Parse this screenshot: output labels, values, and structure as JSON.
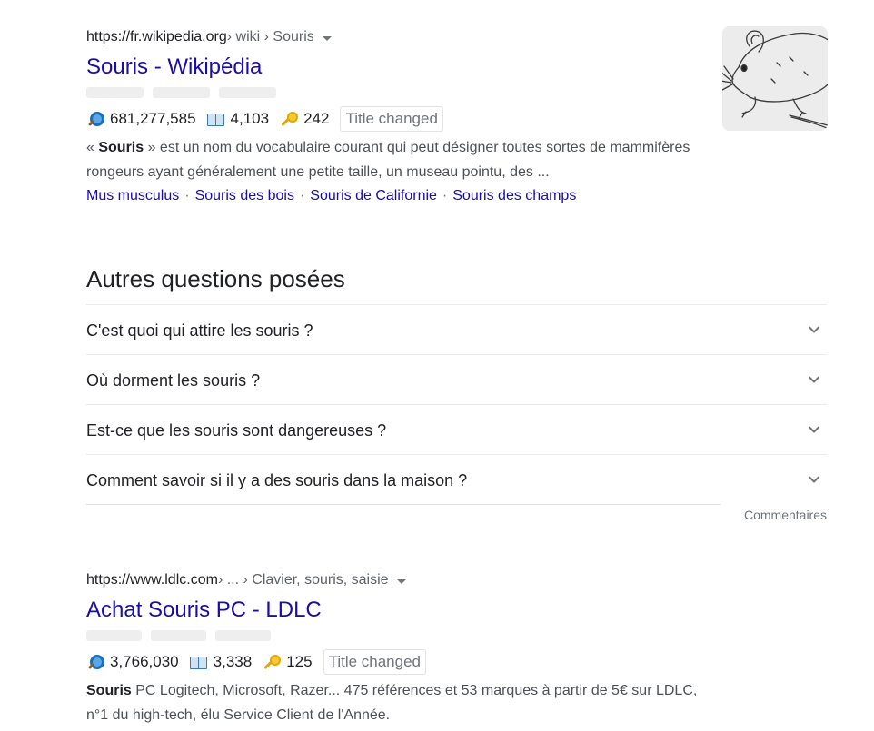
{
  "results": [
    {
      "url_host": "https://fr.wikipedia.org",
      "url_path": " › wiki › Souris",
      "title": "Souris - Wikipédia",
      "stats": {
        "searches": "681,277,585",
        "pages": "4,103",
        "keys": "242",
        "badge": "Title changed"
      },
      "snippet_open": "« ",
      "snippet_bold": "Souris",
      "snippet_rest": " » est un nom du vocabulaire courant qui peut désigner toutes sortes de mammifères rongeurs ayant généralement une petite taille, un museau pointu, des ...",
      "sitelinks": [
        "Mus musculus",
        "Souris des bois",
        "Souris de Californie",
        "Souris des champs"
      ],
      "sitelink_sep": "·"
    },
    {
      "url_host": "https://www.ldlc.com",
      "url_path": " › ... › Clavier, souris, saisie",
      "title": "Achat Souris PC - LDLC",
      "stats": {
        "searches": "3,766,030",
        "pages": "3,338",
        "keys": "125",
        "badge": "Title changed"
      },
      "snippet_bold": "Souris",
      "snippet_rest": " PC Logitech, Microsoft, Razer... 475 références et 53 marques à partir de 5€ sur LDLC, n°1 du high-tech, élu Service Client de l'Année."
    }
  ],
  "paa": {
    "title": "Autres questions posées",
    "questions": [
      "C'est quoi qui attire les souris ?",
      "Où dorment les souris ?",
      "Est-ce que les souris sont dangereuses ?",
      "Comment savoir si il y a des souris dans la maison ?"
    ],
    "feedback": "Commentaires"
  },
  "icons": {
    "search": "magnifier-icon",
    "book": "book-icon",
    "key": "key-icon",
    "caret": "caret-down-icon",
    "chevron": "chevron-down-icon"
  },
  "colors": {
    "link": "#1a0dab",
    "text": "#202124",
    "muted": "#70757a",
    "snippet": "#4d5156"
  }
}
